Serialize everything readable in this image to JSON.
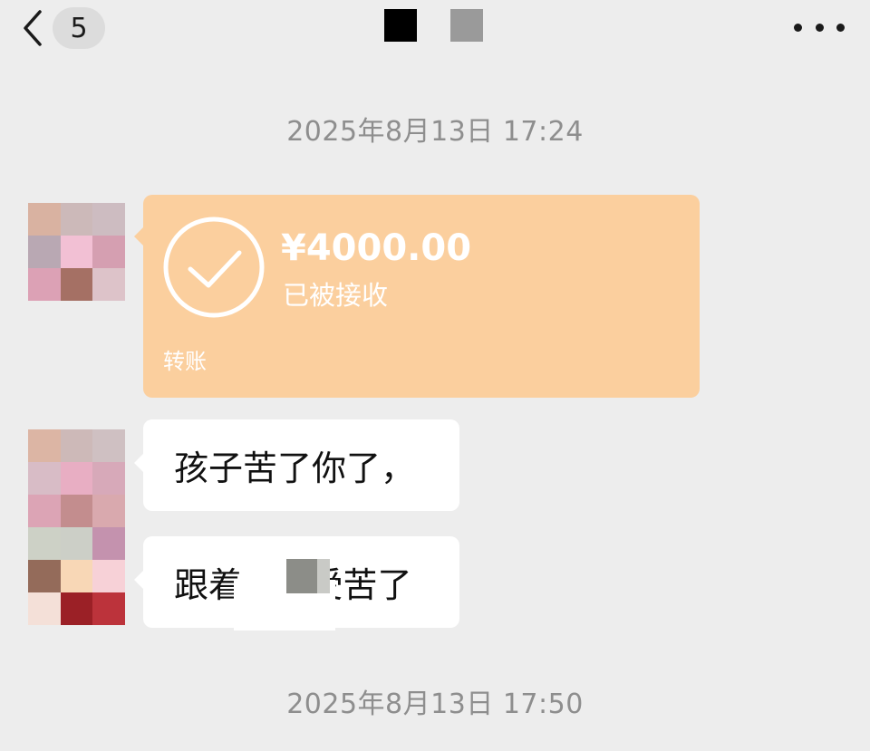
{
  "header": {
    "back_icon": "chevron-left-icon",
    "unread_count": "5",
    "more_icon": "more-horizontal-icon"
  },
  "messages": {
    "timestamp_1": "2025年8月13日 17:24",
    "transfer": {
      "amount": "¥4000.00",
      "status": "已被接收",
      "label": "转账",
      "icon": "check-circle-icon",
      "color": "#fbcf9e"
    },
    "text_1": "孩子苦了你了，",
    "text_2": "跟着      受苦了",
    "timestamp_2": "2025年8月13日 17:50"
  },
  "colors": {
    "background": "#ededed",
    "bubble": "#ffffff",
    "timestamp": "#8e8e8e"
  }
}
